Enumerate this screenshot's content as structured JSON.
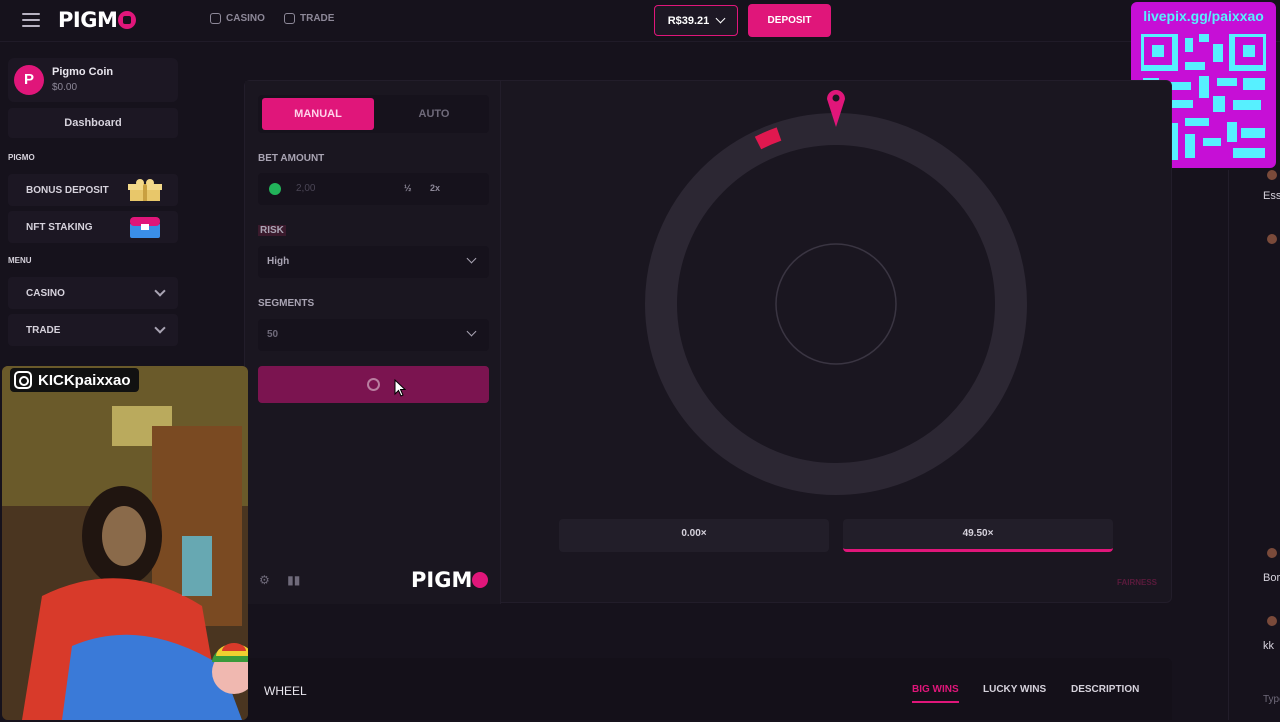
{
  "header": {
    "logo": "PIGM",
    "nav": [
      {
        "label": "CASINO"
      },
      {
        "label": "TRADE"
      }
    ],
    "balance": "R$39.21",
    "deposit_label": "DEPOSIT"
  },
  "overlay": {
    "qr_text": "livepix.gg/paixxao",
    "streamer_handle": "KICKpaixxao"
  },
  "sidebar": {
    "coin_name": "Pigmo Coin",
    "coin_value": "$0.00",
    "dashboard_label": "Dashboard",
    "section_pigmo": "PIGMO",
    "bonus_label": "BONUS DEPOSIT",
    "staking_label": "NFT STAKING",
    "section_menu": "MENU",
    "casino_label": "CASINO",
    "trade_label": "TRADE"
  },
  "game": {
    "tab_manual": "MANUAL",
    "tab_auto": "AUTO",
    "bet_amount_label": "BET AMOUNT",
    "bet_amount_value": "2,00",
    "half_label": "½",
    "double_label": "2x",
    "risk_label": "RISK",
    "risk_value": "High",
    "segments_label": "SEGMENTS",
    "segments_value": "50",
    "footer_logo": "PIGM",
    "multipliers": [
      "0.00×",
      "49.50×"
    ],
    "fairness_label": "FAIRNESS"
  },
  "bottom": {
    "title": "WHEEL",
    "tabs": [
      "BIG WINS",
      "LUCKY WINS",
      "DESCRIPTION"
    ]
  },
  "chat_fragments": [
    "Ess",
    "Bor",
    "kk",
    "Type"
  ],
  "colors": {
    "accent": "#e0167a",
    "background": "#16121c",
    "panel": "#1a1620"
  }
}
